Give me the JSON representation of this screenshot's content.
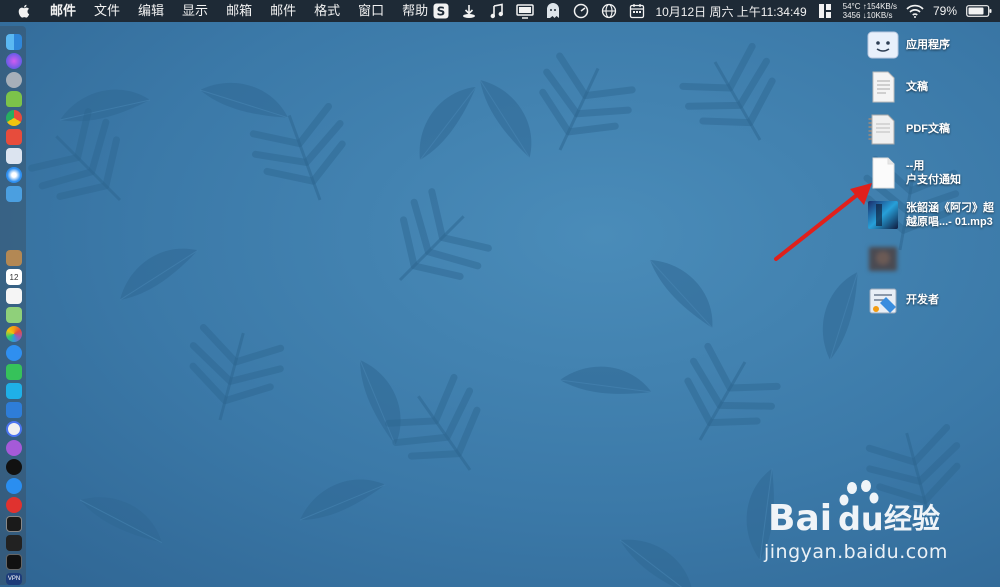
{
  "menubar": {
    "apple": "apple-logo",
    "menus": [
      "邮件",
      "文件",
      "编辑",
      "显示",
      "邮箱",
      "邮件",
      "格式",
      "窗口",
      "帮助"
    ],
    "status": {
      "datetime": "10月12日 周六 上午11:34:49",
      "net_up": "54°C ↑154KB/s",
      "net_down": "3456 ↓10KB/s",
      "battery": "79%"
    }
  },
  "desktop": {
    "items": [
      {
        "label": "应用程序",
        "icon": "finder-folder-icon"
      },
      {
        "label": "文稿",
        "icon": "document-icon"
      },
      {
        "label": "PDF文稿",
        "icon": "pdf-document-icon"
      },
      {
        "label": "--用\n户支付通知",
        "icon": "blank-file-icon"
      },
      {
        "label": "张韶涵《阿刁》超\n越原唱...- 01.mp3",
        "icon": "mp3-file-icon"
      },
      {
        "label": "",
        "icon": "blurred-image-icon"
      },
      {
        "label": "开发者",
        "icon": "developer-folder-icon"
      }
    ]
  },
  "dock": {
    "apps": [
      "finder",
      "siri",
      "launchpad",
      "android",
      "chrome",
      "calendar-mini",
      "safari",
      "preview",
      "notes-brown",
      "calendar",
      "reminders",
      "maps",
      "photos",
      "messages",
      "facetime",
      "messages-badge",
      "keynote",
      "music",
      "podcasts",
      "tv",
      "appstore",
      "vivaldi",
      "terminal",
      "activity",
      "terminal-dark",
      "vpn",
      "yandex"
    ],
    "calendar_day": "12",
    "vpn_label": "VPN"
  },
  "watermark": {
    "brand_text": "Bai",
    "brand_text2": "du",
    "brand_suffix": "经验",
    "url": "jingyan.baidu.com"
  },
  "colors": {
    "menubar": "#1e2a36",
    "wallpaper": "#3b78a6",
    "arrow": "#e0201b"
  }
}
